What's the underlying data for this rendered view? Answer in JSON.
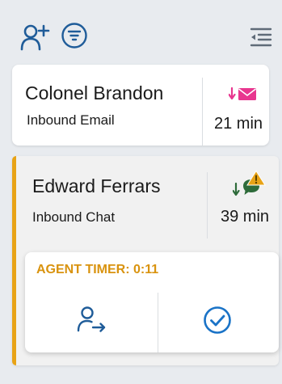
{
  "toolbar": {
    "add_icon": "person-add-icon",
    "filter_icon": "filter-icon",
    "collapse_icon": "collapse-panel-icon"
  },
  "interactions": [
    {
      "name": "Colonel Brandon",
      "channel": "Inbound Email",
      "channel_icon": "inbound-email-icon",
      "time": "21 min"
    },
    {
      "name": "Edward Ferrars",
      "channel": "Inbound Chat",
      "channel_icon": "inbound-chat-warning-icon",
      "time": "39 min",
      "agent_timer": "AGENT TIMER: 0:11",
      "actions": {
        "transfer_icon": "transfer-icon",
        "complete_icon": "complete-check-icon"
      }
    }
  ],
  "colors": {
    "accent_blue": "#1f5c99",
    "email_pink": "#e8368f",
    "chat_green": "#2e6b3a",
    "warning_orange": "#e8a316",
    "active_bar": "#e8a316",
    "check_blue": "#1a73c7"
  }
}
